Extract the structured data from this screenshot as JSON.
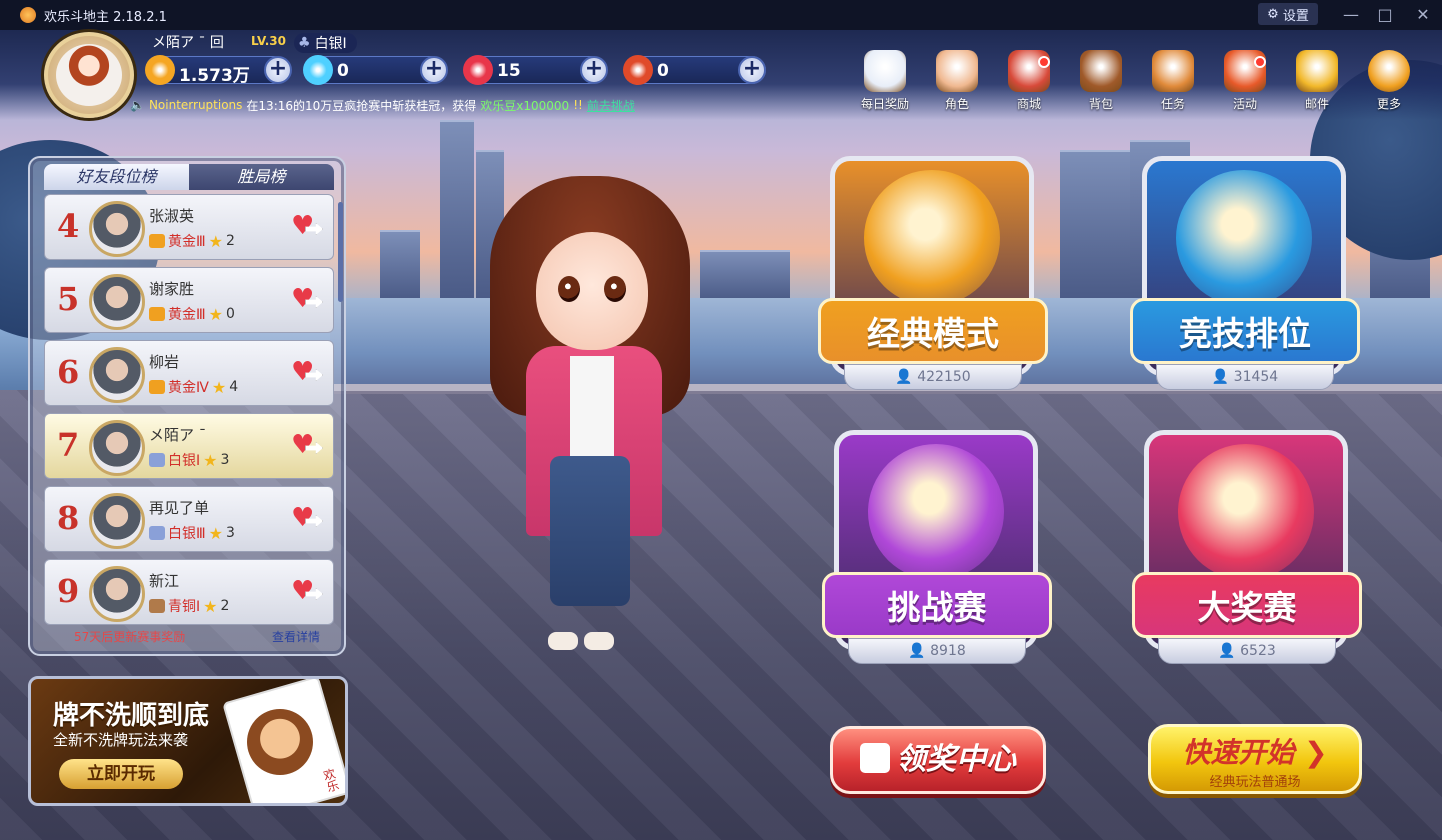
{
  "window": {
    "title": "欢乐斗地主 2.18.2.1",
    "settings_label": "设置",
    "min_symbol": "—",
    "max_symbol": "□",
    "close_symbol": "✕"
  },
  "player": {
    "name": "メ陌ア ˉ 回",
    "level": "LV.30",
    "rank": "白银Ⅰ"
  },
  "resources": [
    {
      "name": "beans",
      "value": "1.573万",
      "icon": "bean-icon",
      "color": "#f5a623"
    },
    {
      "name": "diamonds",
      "value": "0",
      "icon": "diamond-icon",
      "color": "#4fd0ff"
    },
    {
      "name": "hearts",
      "value": "15",
      "icon": "heart-icon",
      "color": "#e8364a"
    },
    {
      "name": "coupons",
      "value": "0",
      "icon": "coupon-icon",
      "color": "#e04a2a"
    }
  ],
  "marquee": {
    "player": "Nointerruptions",
    "text1": "在13:16的10万豆疯抢赛中斩获桂冠，获得",
    "reward": "欢乐豆x100000",
    "text2": "!!",
    "link": "前去挑战"
  },
  "topnav": [
    {
      "label": "每日奖励",
      "icon": "calendar-icon",
      "badge": false,
      "color": "#e8eef8"
    },
    {
      "label": "角色",
      "icon": "character-icon",
      "badge": false,
      "color": "#f0b890"
    },
    {
      "label": "商城",
      "icon": "shop-icon",
      "badge": true,
      "color": "#d84a3a"
    },
    {
      "label": "背包",
      "icon": "backpack-icon",
      "badge": false,
      "color": "#a05a2a"
    },
    {
      "label": "任务",
      "icon": "task-icon",
      "badge": false,
      "color": "#e08a3a"
    },
    {
      "label": "活动",
      "icon": "gift-icon",
      "badge": true,
      "color": "#e85a2a"
    },
    {
      "label": "邮件",
      "icon": "mail-icon",
      "badge": false,
      "color": "#f2b82a"
    },
    {
      "label": "更多",
      "icon": "more-icon",
      "badge": false,
      "color": "#f0a020"
    }
  ],
  "leaderboard": {
    "tabs": [
      "好友段位榜",
      "胜局榜"
    ],
    "rows": [
      {
        "rank": "4",
        "name": "张淑英",
        "tier": "黄金Ⅲ",
        "stars": "2",
        "tier_color": "#f0a020"
      },
      {
        "rank": "5",
        "name": "谢家胜",
        "tier": "黄金Ⅲ",
        "stars": "0",
        "tier_color": "#f0a020"
      },
      {
        "rank": "6",
        "name": "柳岩",
        "tier": "黄金Ⅳ",
        "stars": "4",
        "tier_color": "#f0a020"
      },
      {
        "rank": "7",
        "name": "メ陌ア ˉ",
        "tier": "白银Ⅰ",
        "stars": "3",
        "tier_color": "#8aa0d8",
        "me": true
      },
      {
        "rank": "8",
        "name": "再见了单",
        "tier": "白银Ⅲ",
        "stars": "3",
        "tier_color": "#8aa0d8"
      },
      {
        "rank": "9",
        "name": "新江",
        "tier": "青铜Ⅰ",
        "stars": "2",
        "tier_color": "#b07a4a"
      }
    ],
    "footer_note": "57天后更新赛事奖励",
    "footer_link": "查看详情"
  },
  "promo": {
    "title": "牌不洗顺到底",
    "subtitle": "全新不洗牌玩法来袭",
    "button": "立即开玩",
    "card_text": "欢乐"
  },
  "modes": [
    {
      "label": "经典模式",
      "players": "422150",
      "icon": "farmer-icon",
      "panel": "#e8902a",
      "ribbon": "#f0a020"
    },
    {
      "label": "竞技排位",
      "players": "31454",
      "icon": "star-icon",
      "panel": "#2a78d0",
      "ribbon": "#2a9ae0"
    },
    {
      "label": "挑战赛",
      "players": "8918",
      "icon": "trophy-icon",
      "panel": "#9a3ac8",
      "ribbon": "#b048d8"
    },
    {
      "label": "大奖赛",
      "players": "6523",
      "icon": "present-icon",
      "panel": "#d8367a",
      "ribbon": "#e83a60"
    }
  ],
  "actions": {
    "claim": "领奖中心",
    "quick": "快速开始",
    "quick_sub": "经典玩法普通场"
  }
}
